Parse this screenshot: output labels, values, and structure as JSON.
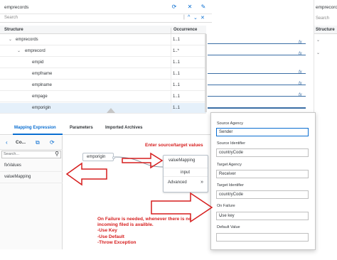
{
  "structure_panel": {
    "title": "emprecords",
    "search_placeholder": "Search",
    "header_structure": "Structure",
    "header_occurrence": "Occurrence",
    "rows": [
      {
        "name": "emprecords",
        "occurrence": "1..1",
        "expanded": true
      },
      {
        "name": "emprecord",
        "occurrence": "1..*",
        "expanded": true
      },
      {
        "name": "empid",
        "occurrence": "1..1"
      },
      {
        "name": "empfname",
        "occurrence": "1..1"
      },
      {
        "name": "emplname",
        "occurrence": "1..1"
      },
      {
        "name": "empage",
        "occurrence": "1..1"
      },
      {
        "name": "emporigin",
        "occurrence": "1..1",
        "selected": true
      }
    ]
  },
  "target_panel": {
    "title": "emprecords",
    "search_placeholder": "Search",
    "header_structure": "Structure"
  },
  "mapping_lines": {
    "fx_symbol": "fx",
    "count": 6
  },
  "tabs": {
    "items": [
      {
        "label": "Mapping Expression",
        "active": true
      },
      {
        "label": "Parameters",
        "active": false
      },
      {
        "label": "Imported Archives",
        "active": false
      }
    ]
  },
  "functions_pane": {
    "title": "Co...",
    "search_placeholder": "Search...",
    "items": [
      "fixValues",
      "valueMapping"
    ]
  },
  "canvas": {
    "source_node": "emporigin",
    "function_title": "valueMapping",
    "function_input": "input",
    "function_advanced": "Advanced"
  },
  "properties": {
    "source_agency_label": "Source Agency",
    "source_agency_value": "Sender",
    "source_identifier_label": "Source Identifier",
    "source_identifier_value": "countryCode",
    "target_agency_label": "Target Agency",
    "target_agency_value": "Receiver",
    "target_identifier_label": "Target Identifier",
    "target_identifier_value": "countryCode",
    "on_failure_label": "On Failure",
    "on_failure_value": "Use key",
    "default_value_label": "Default Value",
    "default_value_value": ""
  },
  "annotations": {
    "enter_values": "Enter source/target values",
    "on_failure_1": "On Failure is needed, whenever there is no",
    "on_failure_2": "incoming filed is availble.",
    "opt_1": "-Use Key",
    "opt_2": "-Use Default",
    "opt_3": "-Throw Exception"
  },
  "colors": {
    "accent": "#0a6ed1",
    "annotation_red": "#d61d1d",
    "mapping_line": "#3a6ea5",
    "selected_row": "#e5f0fa"
  },
  "icons": {
    "expand_icon": "chevron-down",
    "back_icon": "chevron-left",
    "search_icon": "magnifier",
    "refresh_icon": "refresh",
    "close_icon": "close",
    "edit_icon": "pencil",
    "advanced_icon": "double-chevron-right",
    "dropdown_icon": "chevron-down"
  }
}
